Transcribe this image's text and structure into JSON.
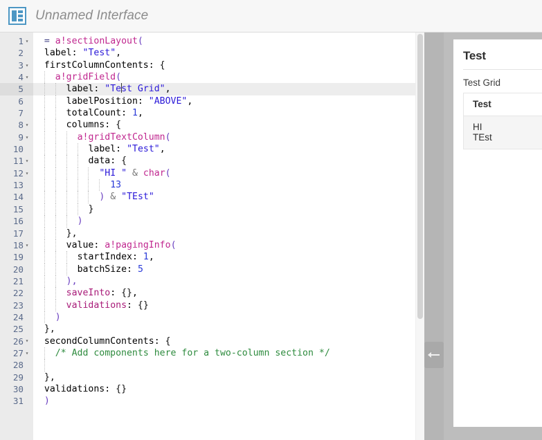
{
  "header": {
    "icon": "interface-layout-icon",
    "title": "Unnamed Interface",
    "accent_color": "#4d97c4"
  },
  "editor": {
    "current_line": 5,
    "total_lines": 31,
    "lines": [
      {
        "n": "1",
        "fold": true,
        "indent": 0
      },
      {
        "n": "2",
        "fold": false,
        "indent": 1
      },
      {
        "n": "3",
        "fold": true,
        "indent": 1
      },
      {
        "n": "4",
        "fold": true,
        "indent": 2
      },
      {
        "n": "5",
        "fold": false,
        "indent": 3
      },
      {
        "n": "6",
        "fold": false,
        "indent": 3
      },
      {
        "n": "7",
        "fold": false,
        "indent": 3
      },
      {
        "n": "8",
        "fold": true,
        "indent": 3
      },
      {
        "n": "9",
        "fold": true,
        "indent": 4
      },
      {
        "n": "10",
        "fold": false,
        "indent": 5
      },
      {
        "n": "11",
        "fold": true,
        "indent": 5
      },
      {
        "n": "12",
        "fold": true,
        "indent": 6
      },
      {
        "n": "13",
        "fold": false,
        "indent": 7
      },
      {
        "n": "14",
        "fold": false,
        "indent": 6
      },
      {
        "n": "15",
        "fold": false,
        "indent": 5
      },
      {
        "n": "16",
        "fold": false,
        "indent": 4
      },
      {
        "n": "17",
        "fold": false,
        "indent": 3
      },
      {
        "n": "18",
        "fold": true,
        "indent": 3
      },
      {
        "n": "19",
        "fold": false,
        "indent": 4
      },
      {
        "n": "20",
        "fold": false,
        "indent": 4
      },
      {
        "n": "21",
        "fold": false,
        "indent": 3
      },
      {
        "n": "22",
        "fold": false,
        "indent": 3
      },
      {
        "n": "23",
        "fold": false,
        "indent": 3
      },
      {
        "n": "24",
        "fold": false,
        "indent": 2
      },
      {
        "n": "25",
        "fold": false,
        "indent": 1
      },
      {
        "n": "26",
        "fold": true,
        "indent": 1
      },
      {
        "n": "27",
        "fold": true,
        "indent": 2
      },
      {
        "n": "28",
        "fold": false,
        "indent": 2
      },
      {
        "n": "29",
        "fold": false,
        "indent": 1
      },
      {
        "n": "30",
        "fold": false,
        "indent": 1
      },
      {
        "n": "31",
        "fold": false,
        "indent": 0
      }
    ],
    "code_text": {
      "l1": "= a!sectionLayout(",
      "l2": "label: \"Test\",",
      "l3": "firstColumnContents: {",
      "l4": "a!gridField(",
      "l5": "label: \"Test Grid\",",
      "l6": "labelPosition: \"ABOVE\",",
      "l7": "totalCount: 1,",
      "l8": "columns: {",
      "l9": "a!gridTextColumn(",
      "l10": "label: \"Test\",",
      "l11": "data: {",
      "l12": "\"HI \" & char(",
      "l13": "13",
      "l14": ") & \"TEst\"",
      "l15": "}",
      "l16": ")",
      "l17": "},",
      "l18": "value: a!pagingInfo(",
      "l19": "startIndex: 1,",
      "l20": "batchSize: 5",
      "l21": "),",
      "l22": "saveInto: {},",
      "l23": "validations: {}",
      "l24": ")",
      "l25": "},",
      "l26": "secondColumnContents: {",
      "l27": "/* Add components here for a two-column section */",
      "l28": "",
      "l29": "},",
      "l30": "validations: {}",
      "l31": ")"
    },
    "tokens": {
      "eq": "=",
      "fn_sectionLayout": "a!sectionLayout",
      "fn_gridField": "a!gridField",
      "fn_gridTextColumn": "a!gridTextColumn",
      "fn_pagingInfo": "a!pagingInfo",
      "fn_char": "char",
      "key_label": "label",
      "key_firstColumnContents": "firstColumnContents",
      "key_labelPosition": "labelPosition",
      "key_totalCount": "totalCount",
      "key_columns": "columns",
      "key_data": "data",
      "key_value": "value",
      "key_startIndex": "startIndex",
      "key_batchSize": "batchSize",
      "key_saveInto": "saveInto",
      "key_validations": "validations",
      "key_secondColumnContents": "secondColumnContents",
      "str_Test": "\"Test\"",
      "str_TestGrid_a": "\"Te",
      "str_TestGrid_b": "st Grid\"",
      "str_ABOVE": "\"ABOVE\"",
      "str_HI": "\"HI \"",
      "str_TEst": "\"TEst\"",
      "num_1": "1",
      "num_13": "13",
      "num_5": "5",
      "amp": "&",
      "comment": "/* Add components here for a two-column section */",
      "empty_braces": "{}",
      "open_brace": "{",
      "close_brace": "}",
      "close_brace_comma": "},",
      "open_paren": "(",
      "close_paren": ")",
      "close_paren_comma": "),",
      "comma": ",",
      "colon": ":",
      "fold_glyph": "▾"
    },
    "colors": {
      "function": "#c0278f",
      "string": "#2a18d8",
      "number": "#2a3ad8",
      "comment": "#2e8b3e",
      "paren": "#6a3fc0",
      "current_line_bg": "#ededed",
      "gutter_bg": "#ebebeb"
    }
  },
  "splitter": {
    "name": "pane-splitter",
    "handle_icon": "drag-left-arrow-icon"
  },
  "preview": {
    "section_title": "Test",
    "grid_label": "Test Grid",
    "grid": {
      "columns": [
        "Test"
      ],
      "rows": [
        {
          "line1": "HI",
          "line2": "TEst"
        }
      ]
    }
  }
}
